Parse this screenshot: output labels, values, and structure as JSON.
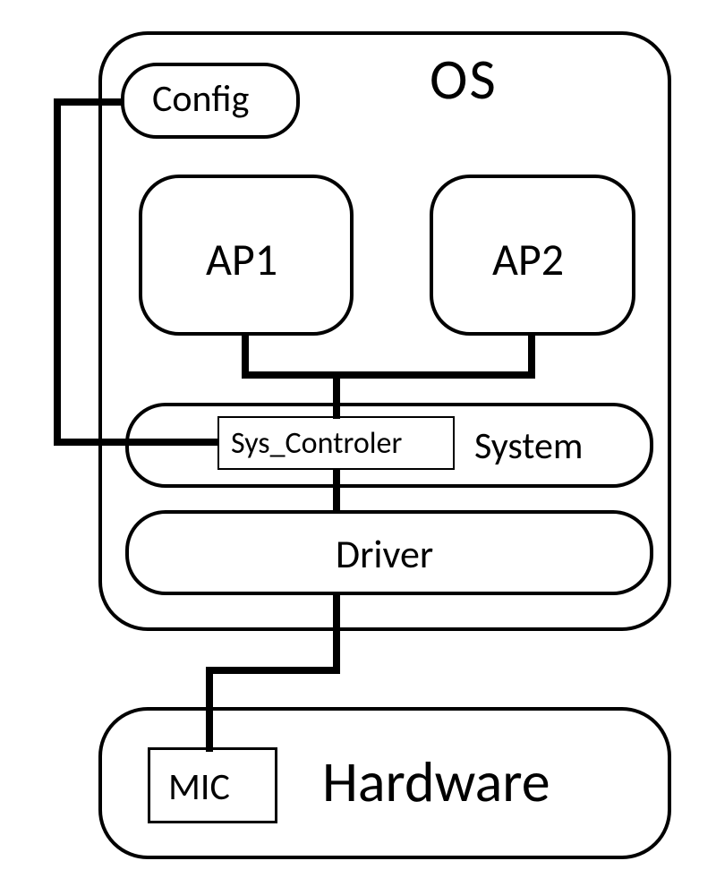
{
  "diagram": {
    "os_label": "OS",
    "config_label": "Config",
    "ap1_label": "AP1",
    "ap2_label": "AP2",
    "sys_controler_label": "Sys_Controler",
    "system_label": "System",
    "driver_label": "Driver",
    "hardware_label": "Hardware",
    "mic_label": "MIC"
  }
}
